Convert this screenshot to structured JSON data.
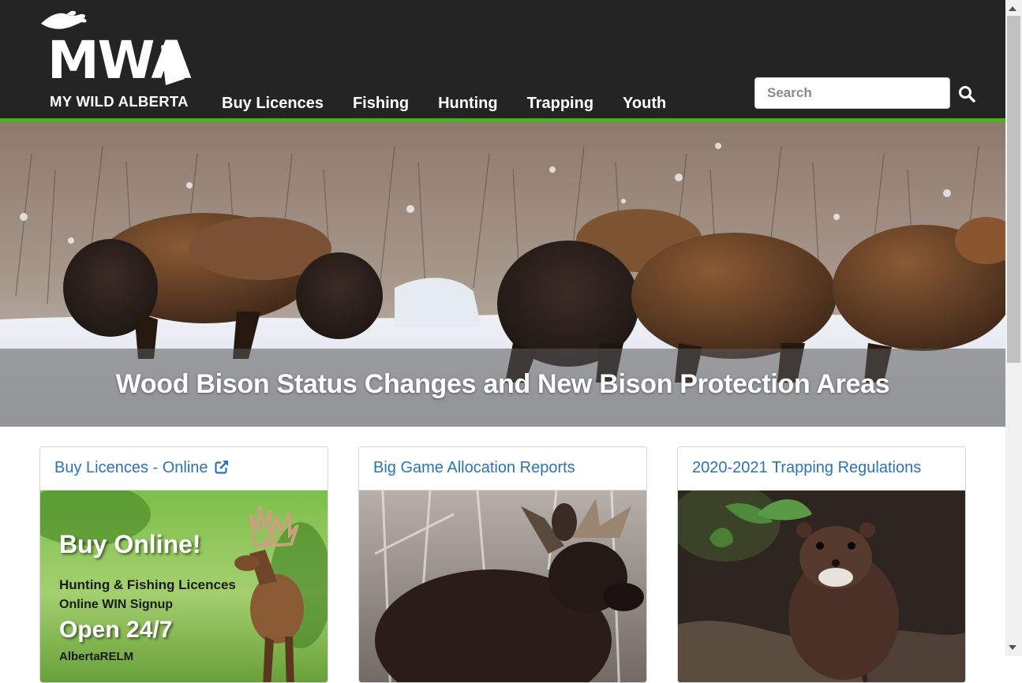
{
  "brand": {
    "logo_text": "MWA",
    "tagline": "MY WILD ALBERTA"
  },
  "nav": {
    "items": [
      "Buy Licences",
      "Fishing",
      "Hunting",
      "Trapping",
      "Youth"
    ]
  },
  "search": {
    "placeholder": "Search"
  },
  "hero": {
    "title": "Wood Bison Status Changes and New Bison Protection Areas"
  },
  "cards": [
    {
      "title": "Buy Licences - Online",
      "external_icon": "external-link-icon",
      "promo": {
        "headline": "Buy Online!",
        "line1": "Hunting & Fishing Licences",
        "line2": "Online WIN Signup",
        "headline2": "Open 24/7",
        "line3": "AlbertaRELM"
      }
    },
    {
      "title": "Big Game Allocation Reports"
    },
    {
      "title": "2020-2021 Trapping Regulations"
    }
  ],
  "colors": {
    "header_bg": "#242424",
    "accent_green": "#4caf1e",
    "link_blue": "#2a73b8"
  }
}
